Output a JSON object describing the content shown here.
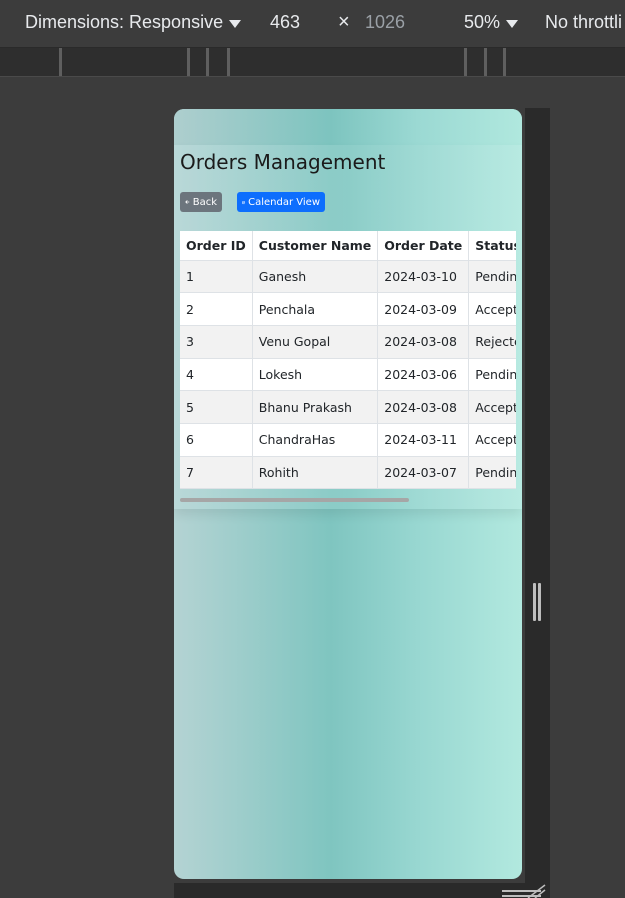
{
  "devtools": {
    "dimensions_label": "Dimensions: Responsive",
    "width": "463",
    "times": "×",
    "height": "1026",
    "zoom": "50%",
    "throttle": "No throttli"
  },
  "page": {
    "title": "Orders Management",
    "back_label": "Back",
    "calendar_label": "Calendar View"
  },
  "table": {
    "headers": [
      "Order ID",
      "Customer Name",
      "Order Date",
      "Status",
      ""
    ],
    "rows": [
      [
        "1",
        "Ganesh",
        "2024-03-10",
        "Pending",
        ""
      ],
      [
        "2",
        "Penchala",
        "2024-03-09",
        "Accepted",
        ""
      ],
      [
        "3",
        "Venu Gopal",
        "2024-03-08",
        "Rejected",
        ""
      ],
      [
        "4",
        "Lokesh",
        "2024-03-06",
        "Pending",
        ""
      ],
      [
        "5",
        "Bhanu Prakash",
        "2024-03-08",
        "Accepted",
        ""
      ],
      [
        "6",
        "ChandraHas",
        "2024-03-11",
        "Accepted",
        ""
      ],
      [
        "7",
        "Rohith",
        "2024-03-07",
        "Pending",
        ""
      ]
    ]
  },
  "colors": {
    "back_button": "#6c757d",
    "calendar_button": "#0d6efd",
    "toolbar_bg": "#3c3c3c"
  }
}
